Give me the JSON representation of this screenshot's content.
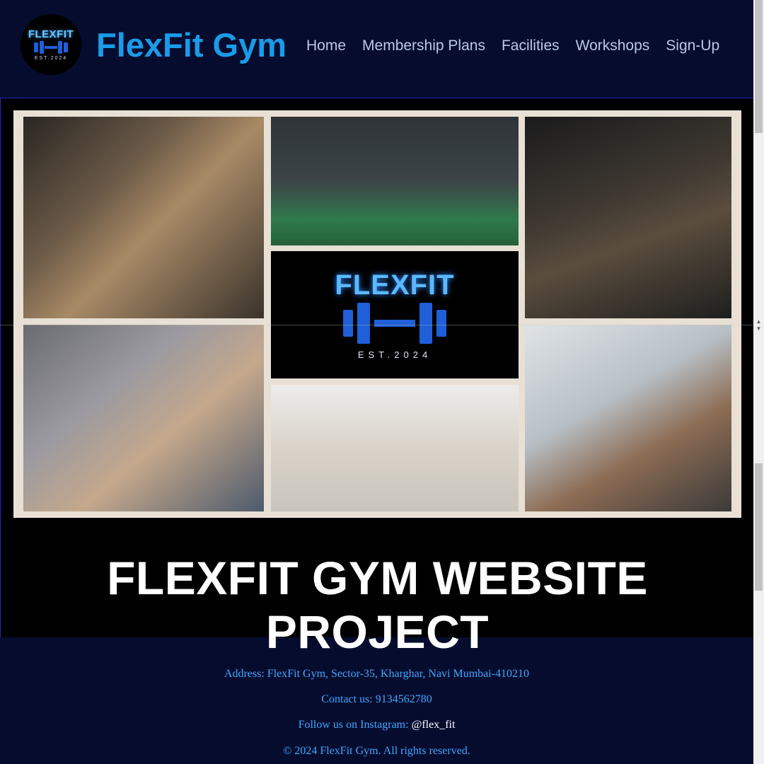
{
  "header": {
    "logo": {
      "text": "FLEXFIT",
      "est": "EST.2024"
    },
    "brand": "FlexFit Gym",
    "nav": [
      "Home",
      "Membership Plans",
      "Facilities",
      "Workshops",
      "Sign-Up"
    ]
  },
  "hero": {
    "collage_logo": {
      "text": "FLEXFIT",
      "est": "EST.2024"
    },
    "title": "FLEXFIT GYM WEBSITE PROJECT"
  },
  "footer": {
    "address": "Address: FlexFit Gym, Sector-35, Kharghar, Navi Mumbai-410210",
    "contact": "Contact us: 9134562780",
    "follow_label": "Follow us on Instagram: ",
    "instagram": "@flex_fit",
    "copyright": "© 2024 FlexFit Gym. All rights reserved."
  },
  "colors": {
    "background": "#050c2e",
    "brand": "#1a9be8",
    "footer_text": "#3ea8ff",
    "accent_border": "#2224c8"
  }
}
